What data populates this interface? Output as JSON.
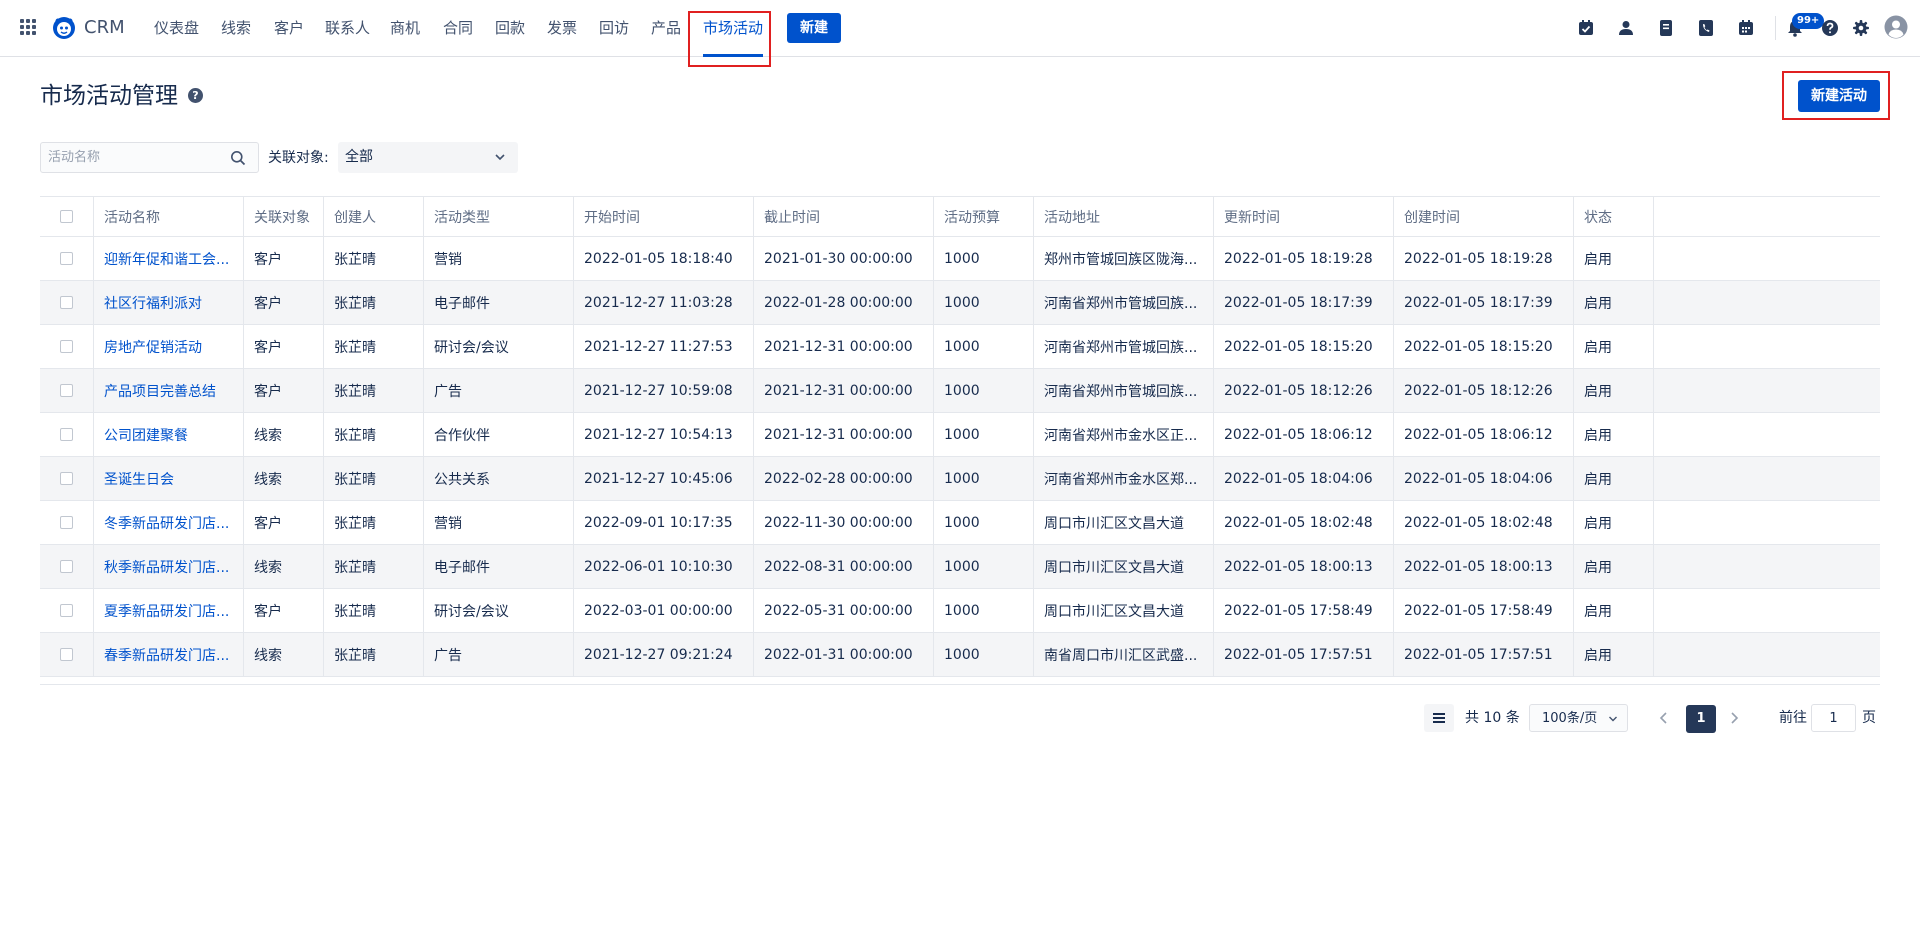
{
  "app": {
    "name": "CRM"
  },
  "nav": {
    "items": [
      "仪表盘",
      "线索",
      "客户",
      "联系人",
      "商机",
      "合同",
      "回款",
      "发票",
      "回访",
      "产品",
      "市场活动"
    ],
    "active": "市场活动",
    "new_label": "新建",
    "notification_badge": "99+",
    "icons": [
      "calendar-check-icon",
      "person-icon",
      "document-icon",
      "phone-icon",
      "calendar-icon",
      "bell-icon",
      "help-icon",
      "gear-icon",
      "user-avatar-icon"
    ]
  },
  "page": {
    "title": "市场活动管理",
    "help_glyph": "?",
    "create_label": "新建活动"
  },
  "filters": {
    "search_placeholder": "活动名称",
    "related_label": "关联对象:",
    "related_value": "全部"
  },
  "table": {
    "columns": [
      "活动名称",
      "关联对象",
      "创建人",
      "活动类型",
      "开始时间",
      "截止时间",
      "活动预算",
      "活动地址",
      "更新时间",
      "创建时间",
      "状态"
    ],
    "rows": [
      [
        "迎新年促和谐工会...",
        "客户",
        "张芷晴",
        "营销",
        "2022-01-05 18:18:40",
        "2021-01-30 00:00:00",
        "1000",
        "郑州市管城回族区陇海...",
        "2022-01-05 18:19:28",
        "2022-01-05 18:19:28",
        "启用"
      ],
      [
        "社区行福利派对",
        "客户",
        "张芷晴",
        "电子邮件",
        "2021-12-27 11:03:28",
        "2022-01-28 00:00:00",
        "1000",
        "河南省郑州市管城回族...",
        "2022-01-05 18:17:39",
        "2022-01-05 18:17:39",
        "启用"
      ],
      [
        "房地产促销活动",
        "客户",
        "张芷晴",
        "研讨会/会议",
        "2021-12-27 11:27:53",
        "2021-12-31 00:00:00",
        "1000",
        "河南省郑州市管城回族...",
        "2022-01-05 18:15:20",
        "2022-01-05 18:15:20",
        "启用"
      ],
      [
        "产品项目完善总结",
        "客户",
        "张芷晴",
        "广告",
        "2021-12-27 10:59:08",
        "2021-12-31 00:00:00",
        "1000",
        "河南省郑州市管城回族...",
        "2022-01-05 18:12:26",
        "2022-01-05 18:12:26",
        "启用"
      ],
      [
        "公司团建聚餐",
        "线索",
        "张芷晴",
        "合作伙伴",
        "2021-12-27 10:54:13",
        "2021-12-31 00:00:00",
        "1000",
        "河南省郑州市金水区正...",
        "2022-01-05 18:06:12",
        "2022-01-05 18:06:12",
        "启用"
      ],
      [
        "圣诞生日会",
        "线索",
        "张芷晴",
        "公共关系",
        "2021-12-27 10:45:06",
        "2022-02-28 00:00:00",
        "1000",
        "河南省郑州市金水区郑...",
        "2022-01-05 18:04:06",
        "2022-01-05 18:04:06",
        "启用"
      ],
      [
        "冬季新品研发门店...",
        "客户",
        "张芷晴",
        "营销",
        "2022-09-01 10:17:35",
        "2022-11-30 00:00:00",
        "1000",
        "周口市川汇区文昌大道",
        "2022-01-05 18:02:48",
        "2022-01-05 18:02:48",
        "启用"
      ],
      [
        "秋季新品研发门店...",
        "线索",
        "张芷晴",
        "电子邮件",
        "2022-06-01 10:10:30",
        "2022-08-31 00:00:00",
        "1000",
        "周口市川汇区文昌大道",
        "2022-01-05 18:00:13",
        "2022-01-05 18:00:13",
        "启用"
      ],
      [
        "夏季新品研发门店...",
        "客户",
        "张芷晴",
        "研讨会/会议",
        "2022-03-01 00:00:00",
        "2022-05-31 00:00:00",
        "1000",
        "周口市川汇区文昌大道",
        "2022-01-05 17:58:49",
        "2022-01-05 17:58:49",
        "启用"
      ],
      [
        "春季新品研发门店...",
        "线索",
        "张芷晴",
        "广告",
        "2021-12-27 09:21:24",
        "2022-01-31 00:00:00",
        "1000",
        "南省周口市川汇区武盛...",
        "2022-01-05 17:57:51",
        "2022-01-05 17:57:51",
        "启用"
      ]
    ]
  },
  "pagination": {
    "total_label": "共 10 条",
    "page_size": "100条/页",
    "current_page": "1",
    "goto_label": "前往",
    "goto_value": "1",
    "goto_suffix": "页"
  },
  "colors": {
    "brand": "#0052cc",
    "highlight_box": "#e02020",
    "text": "#172b4d",
    "row_alt": "#f4f5f7"
  }
}
